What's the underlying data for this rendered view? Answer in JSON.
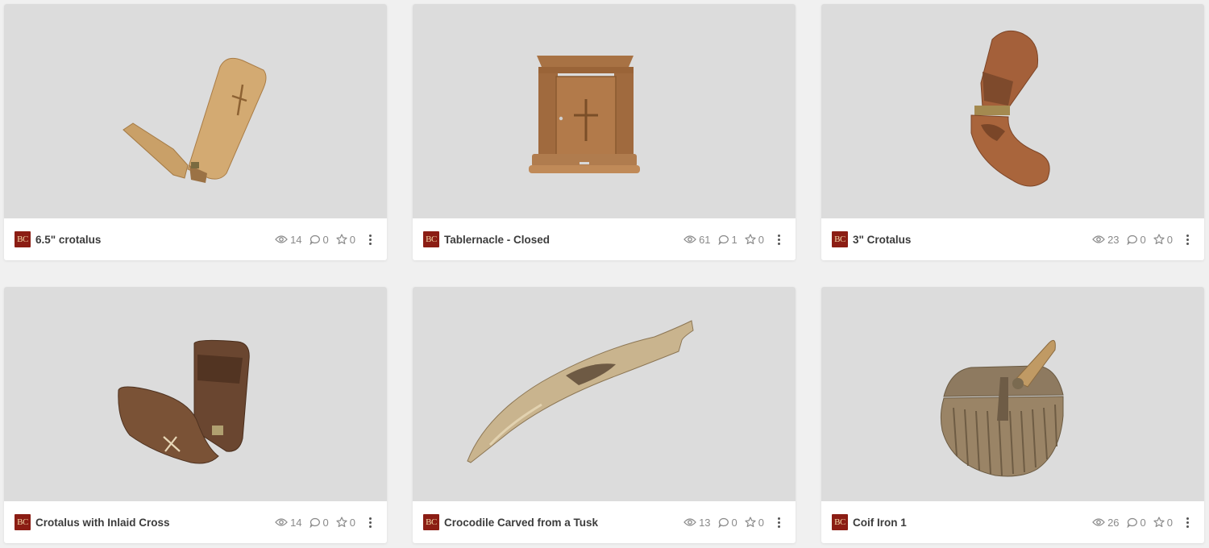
{
  "badge_text": "BC",
  "colors": {
    "badge_bg": "#8b1d14",
    "thumb_bg": "#dcdcdc",
    "page_bg": "#f0f0f0"
  },
  "cards": [
    {
      "title": "6.5\" crotalus",
      "views": "14",
      "comments": "0",
      "likes": "0",
      "icons": [
        "eye-icon",
        "comment-icon",
        "star-icon",
        "more-vertical-icon"
      ]
    },
    {
      "title": "Tablernacle - Closed",
      "views": "61",
      "comments": "1",
      "likes": "0",
      "icons": [
        "eye-icon",
        "comment-icon",
        "star-icon",
        "more-vertical-icon"
      ]
    },
    {
      "title": "3\" Crotalus",
      "views": "23",
      "comments": "0",
      "likes": "0",
      "icons": [
        "eye-icon",
        "comment-icon",
        "star-icon",
        "more-vertical-icon"
      ]
    },
    {
      "title": "Crotalus with Inlaid Cross",
      "views": "14",
      "comments": "0",
      "likes": "0",
      "icons": [
        "eye-icon",
        "comment-icon",
        "star-icon",
        "more-vertical-icon"
      ]
    },
    {
      "title": "Crocodile Carved from a Tusk",
      "views": "13",
      "comments": "0",
      "likes": "0",
      "icons": [
        "eye-icon",
        "comment-icon",
        "star-icon",
        "more-vertical-icon"
      ]
    },
    {
      "title": "Coif Iron 1",
      "views": "26",
      "comments": "0",
      "likes": "0",
      "icons": [
        "eye-icon",
        "comment-icon",
        "star-icon",
        "more-vertical-icon"
      ]
    }
  ]
}
